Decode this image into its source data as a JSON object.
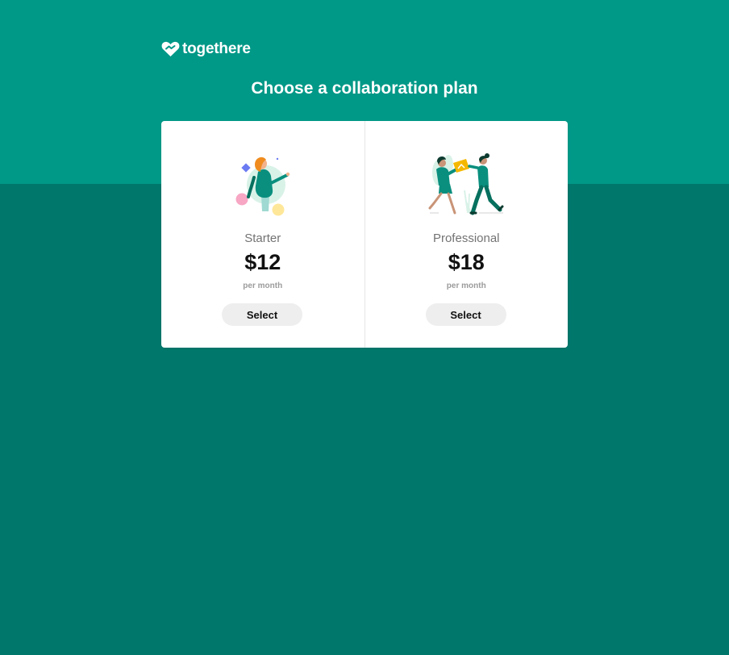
{
  "brand": {
    "name": "togethere",
    "logo_icon": "heart-handshake-icon"
  },
  "page": {
    "title": "Choose a collaboration plan"
  },
  "colors": {
    "header_band": "#009887",
    "background": "#00776b",
    "card": "#ffffff",
    "button": "#eeeeee"
  },
  "plans": [
    {
      "name": "Starter",
      "price": "$12",
      "period": "per month",
      "button_label": "Select",
      "illustration": "person-with-shapes-illustration"
    },
    {
      "name": "Professional",
      "price": "$18",
      "period": "per month",
      "button_label": "Select",
      "illustration": "two-people-collaborating-illustration"
    }
  ]
}
